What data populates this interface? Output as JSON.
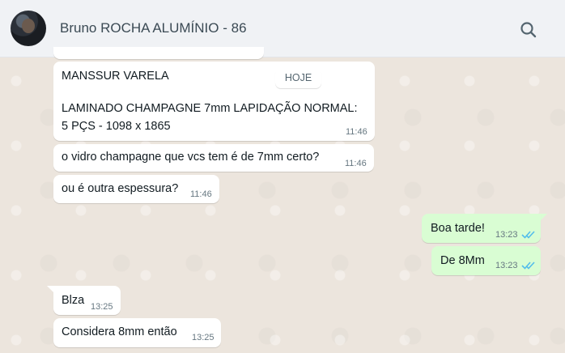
{
  "header": {
    "title": "Bruno ROCHA ALUMÍNIO - 86",
    "avatar": "contact-photo",
    "search_icon": "search-icon"
  },
  "date_chip": "HOJE",
  "messages": [
    {
      "direction": "in",
      "lines": [
        "MANSSUR VARELA",
        "",
        "LAMINADO CHAMPAGNE 7mm LAPIDAÇÃO NORMAL:",
        "5 PÇS - 1098 x 1865"
      ],
      "time": "11:46"
    },
    {
      "direction": "in",
      "text": "o vidro champagne que vcs tem é de 7mm certo?",
      "time": "11:46"
    },
    {
      "direction": "in",
      "text": "ou é outra espessura?",
      "time": "11:46"
    },
    {
      "direction": "out",
      "text": "Boa tarde!",
      "time": "13:23",
      "status": "read"
    },
    {
      "direction": "out",
      "text": "De 8Mm",
      "time": "13:23",
      "status": "read"
    },
    {
      "direction": "in",
      "text": "Blza",
      "time": "13:25"
    },
    {
      "direction": "in",
      "text": "Considera 8mm então",
      "time": "13:25"
    }
  ],
  "colors": {
    "incoming_bubble": "#ffffff",
    "outgoing_bubble": "#d9fdd3",
    "read_ticks": "#53bdeb",
    "header_bg": "#f0f2f5"
  }
}
